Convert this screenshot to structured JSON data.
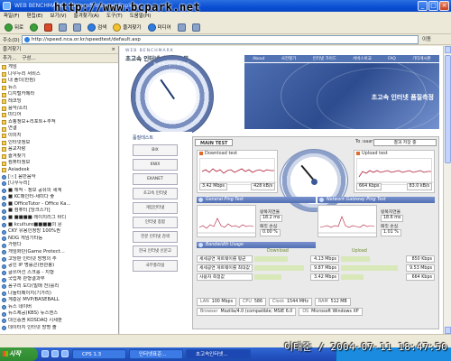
{
  "window": {
    "title": "WEB BENCHMARK - Microsoft Internet Explorer",
    "watermark": "http://www.bcpark.net"
  },
  "menu": [
    "파일(F)",
    "편집(E)",
    "보기(V)",
    "즐겨찾기(A)",
    "도구(T)",
    "도움말(H)"
  ],
  "toolbar": {
    "back": "뒤로",
    "search": "검색",
    "favorites": "즐겨찾기",
    "media": "미디어"
  },
  "address": {
    "label": "주소(D)",
    "url": "http://speed.nca.or.kr/speedtest/default.asp",
    "go": "이동"
  },
  "favorites": {
    "header": "즐겨찾기",
    "tools": [
      "추가...",
      "구성..."
    ],
    "items": [
      {
        "label": "게임",
        "icon": "folder"
      },
      {
        "label": "나우누리 서비스",
        "icon": "folder"
      },
      {
        "label": "내 폴더(한컴)",
        "icon": "folder"
      },
      {
        "label": "뉴스",
        "icon": "folder"
      },
      {
        "label": "디지털카메라",
        "icon": "folder"
      },
      {
        "label": "레코딩",
        "icon": "folder"
      },
      {
        "label": "음악/소리",
        "icon": "folder"
      },
      {
        "label": "미디어",
        "icon": "folder"
      },
      {
        "label": "쇼핑정보+리포트+추적",
        "icon": "folder"
      },
      {
        "label": "연결",
        "icon": "folder"
      },
      {
        "label": "이미지",
        "icon": "folder"
      },
      {
        "label": "인터넷정보",
        "icon": "folder"
      },
      {
        "label": "음교자랑",
        "icon": "folder"
      },
      {
        "label": "즐겨찾기",
        "icon": "folder"
      },
      {
        "label": "컴퓨터정보",
        "icon": "folder"
      },
      {
        "label": "Asiadesk",
        "icon": "folder"
      },
      {
        "label": "[ⓒ] 음반음악",
        "icon": "page"
      },
      {
        "label": "[나우누리]",
        "icon": "page"
      },
      {
        "label": "■ 해적 - 정보 공유의 세계",
        "icon": "page"
      },
      {
        "label": "■ KC매인터-세미다 좋",
        "icon": "page"
      },
      {
        "label": "■ OfficeTutor - Office Ka...",
        "icon": "page"
      },
      {
        "label": "■ 컴퓨터 [당크스가]",
        "icon": "page"
      },
      {
        "label": "■ ■■■■ 레이치리그 바디",
        "icon": "page"
      },
      {
        "label": "■ kculture■■■■의 문",
        "icon": "page"
      },
      {
        "label": "CKY 유용인정방 100%권",
        "icon": "page"
      },
      {
        "label": "NDG 게임기타등",
        "icon": "page"
      },
      {
        "label": "가렌다",
        "icon": "page"
      },
      {
        "label": "개임화단(Game Protect...",
        "icon": "page"
      },
      {
        "label": "고당판 인터넷 방명의 추",
        "icon": "page"
      },
      {
        "label": "공인 IP 명률곤(현관봉)",
        "icon": "page"
      },
      {
        "label": "글쓰어선 스크롤 - 지형",
        "icon": "page"
      },
      {
        "label": "국립재 관형결과부",
        "icon": "page"
      },
      {
        "label": "꼼구리 도다(빌매 천)를리",
        "icon": "page"
      },
      {
        "label": "나들터페이지(기가리)",
        "icon": "page"
      },
      {
        "label": "계층운 MVP/BASEBALL",
        "icon": "page"
      },
      {
        "label": "뉴스 네이버",
        "icon": "page"
      },
      {
        "label": "뉴스제공(KBS) 뉴스엔스",
        "icon": "page"
      },
      {
        "label": "대신증권 KOSDAQ 시세판",
        "icon": "page"
      },
      {
        "label": "데이터지 인터넷 방명 출",
        "icon": "page"
      }
    ]
  },
  "site": {
    "logo_top": "WEB BENCHMARK",
    "logo": "초고속 인터넷 속도테스트",
    "nav": [
      "About",
      "사전평가",
      "인터넷 가이드",
      "서비스비교",
      "FAQ",
      "기타게시판"
    ],
    "banner_text": "초고속 인터넷 품질측정",
    "dial_text": "초고속 인터넷 속도"
  },
  "left_col": {
    "title": "품질테스트",
    "promos": [
      "BIX",
      "6NIX",
      "EKANET",
      "초고속 인터넷",
      "게임인터넷",
      "인터넷 종합",
      "전문 인터넷 검색",
      "한국 인터넷 신문고",
      "국무총리실"
    ]
  },
  "panel": {
    "tab_main": "MAIN TEST",
    "server_label": "To :saar",
    "server_value": "결과 저장 중",
    "download": {
      "title": "Download test",
      "unit": "Mbps",
      "value_mbps": "3.42 Mbps",
      "value_kb": "428 kB/s",
      "time_label": "시간"
    },
    "upload": {
      "title": "Upload test",
      "unit": "Mbps",
      "value_mbps": "664 Kbps",
      "value_kb": "83.0 kB/s",
      "time_label": "시간"
    },
    "section_ping": "General Ping Test",
    "section_gateway": "Network Gateway Ping Test",
    "ping_stats": [
      {
        "label": "왕복지연율",
        "value": "18.2 ms"
      },
      {
        "label": "패킷 손실",
        "value": "0.00 %"
      }
    ],
    "gateway_stats": [
      {
        "label": "왕복지연율",
        "value": "18.6 ms"
      },
      {
        "label": "패킷 손실",
        "value": "1.01 %"
      }
    ],
    "section_bandwidth": "Bandwidth Usage",
    "col_download": "Download",
    "col_upload": "Upload",
    "rows": [
      {
        "label": "세세공연 게트웨이를 평균",
        "down": "4.13 Mbps",
        "up": "850 Kbps",
        "down_pct": 0.62,
        "up_pct": 0.45
      },
      {
        "label": "세세공연 게트웨이를 최대값",
        "down": "9.87 Mbps",
        "up": "9.53 Mbps",
        "down_pct": 0.92,
        "up_pct": 0.9
      },
      {
        "label": "사용자 측정값",
        "down": "3.42 Mbps",
        "up": "664 Kbps",
        "down_pct": 0.5,
        "up_pct": 0.35
      }
    ],
    "info1": [
      {
        "k": "LAN",
        "v": "100 Mbps"
      },
      {
        "k": "CPU",
        "v": "586"
      },
      {
        "k": "Clock",
        "v": "1544 MHz"
      },
      {
        "k": "RAM",
        "v": "512 MB"
      }
    ],
    "info2": [
      {
        "k": "Browser",
        "v": "Mozilla/4.0 (compatible; MSIE 6.0"
      },
      {
        "k": "OS",
        "v": "Microsoft Windows XP"
      }
    ]
  },
  "taskbar": {
    "start": "시작",
    "tasks": [
      "CPS 1.3",
      "인터넷표준...",
      "초고속인터넷..."
    ],
    "clock": "이태준 / 2004-07-11 18:47:50"
  }
}
